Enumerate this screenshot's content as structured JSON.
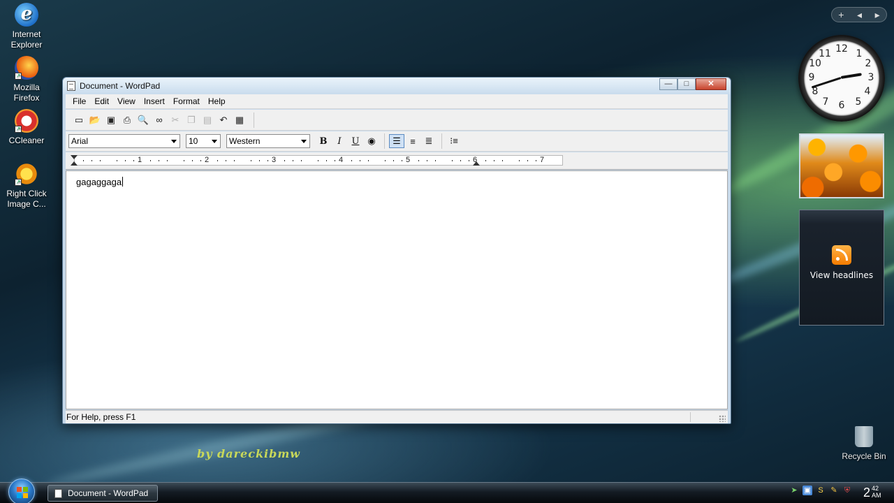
{
  "desktop": {
    "icons": [
      {
        "label": "Internet Explorer"
      },
      {
        "label": "Mozilla Firefox"
      },
      {
        "label": "CCleaner"
      },
      {
        "label": "Right Click Image C..."
      }
    ],
    "recycle_bin_label": "Recycle Bin",
    "signature": "by dareckibmw"
  },
  "sidebar": {
    "controls": {
      "add": "+",
      "prev": "◂",
      "next": "▸"
    },
    "clock_numbers": [
      "12",
      "1",
      "2",
      "3",
      "4",
      "5",
      "6",
      "7",
      "8",
      "9",
      "10",
      "11"
    ],
    "clock_time": {
      "hour": 2,
      "minute": 42
    },
    "feed_label": "View headlines"
  },
  "window": {
    "title": "Document - WordPad",
    "controls": {
      "minimize": "—",
      "maximize": "□",
      "close": "✕"
    },
    "menu": [
      "File",
      "Edit",
      "View",
      "Insert",
      "Format",
      "Help"
    ],
    "format_bar": {
      "font": "Arial",
      "size": "10",
      "script": "Western",
      "bold": "B",
      "italic": "I",
      "underline": "U"
    },
    "ruler_numbers": [
      "1",
      "2",
      "3",
      "4",
      "5",
      "6",
      "7"
    ],
    "document_text": "gagaggaga",
    "status_text": "For Help, press F1"
  },
  "taskbar": {
    "task_label": "Document - WordPad",
    "clock": {
      "hour": "2",
      "minute": "42",
      "ampm": "AM"
    }
  },
  "icons": {
    "new": "new-document-icon",
    "open": "open-folder-icon",
    "save": "save-disk-icon",
    "print": "printer-icon",
    "preview": "print-preview-icon",
    "find": "binoculars-icon",
    "cut": "scissors-icon",
    "copy": "copy-icon",
    "paste": "paste-icon",
    "undo": "undo-icon",
    "datetime": "date-time-icon",
    "color": "palette-icon",
    "align_left": "align-left-icon",
    "align_center": "align-center-icon",
    "align_right": "align-right-icon",
    "bullets": "bullets-icon"
  },
  "colors": {
    "accent": "#5b8bc1",
    "close_button": "#c8442d",
    "signature": "#c8d85a"
  }
}
